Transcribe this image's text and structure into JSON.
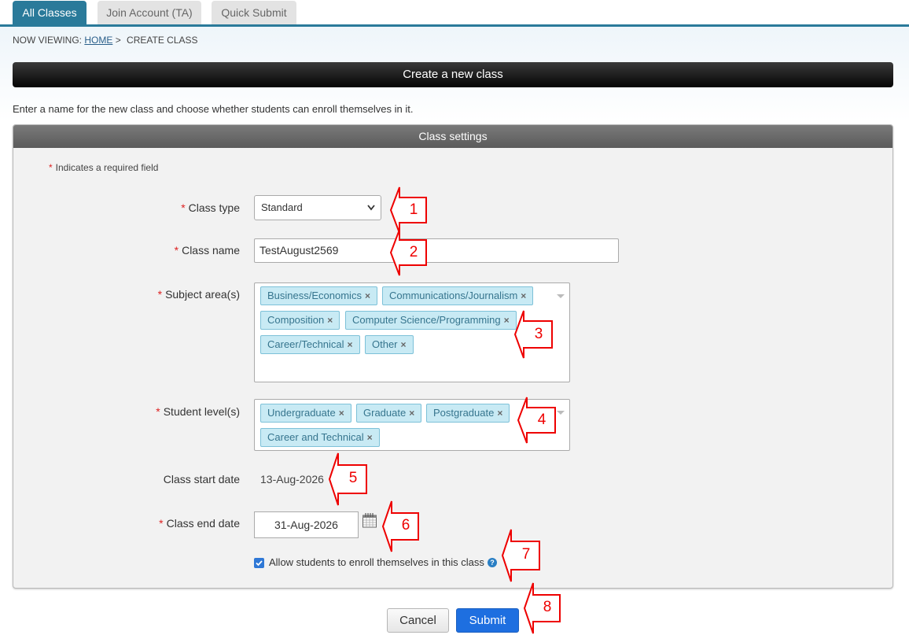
{
  "tabs": [
    {
      "label": "All Classes",
      "active": true
    },
    {
      "label": "Join Account (TA)",
      "active": false
    },
    {
      "label": "Quick Submit",
      "active": false
    }
  ],
  "breadcrumb": {
    "prefix": "NOW VIEWING:",
    "home": "HOME",
    "separator": ">",
    "current": "CREATE CLASS"
  },
  "page_title": "Create a new class",
  "intro_text": "Enter a name for the new class and choose whether students can enroll themselves in it.",
  "panel": {
    "title": "Class settings",
    "required_star": "*",
    "required_note": "Indicates a required field"
  },
  "fields": {
    "class_type": {
      "label": "Class type",
      "value": "Standard"
    },
    "class_name": {
      "label": "Class name",
      "value": "TestAugust2569"
    },
    "subject_areas": {
      "label": "Subject area(s)",
      "tags": [
        "Business/Economics",
        "Communications/Journalism",
        "Composition",
        "Computer Science/Programming",
        "Career/Technical",
        "Other"
      ]
    },
    "student_levels": {
      "label": "Student level(s)",
      "tags": [
        "Undergraduate",
        "Graduate",
        "Postgraduate",
        "Career and Technical"
      ]
    },
    "start_date": {
      "label": "Class start date",
      "value": "13-Aug-2026"
    },
    "end_date": {
      "label": "Class end date",
      "value": "31-Aug-2026"
    },
    "self_enroll": {
      "label": "Allow students to enroll themselves in this class",
      "checked": true,
      "help_glyph": "?"
    }
  },
  "tag_remove_glyph": "×",
  "buttons": {
    "cancel": "Cancel",
    "submit": "Submit"
  },
  "callouts": [
    "1",
    "2",
    "3",
    "4",
    "5",
    "6",
    "7",
    "8"
  ],
  "colors": {
    "accent": "#2a7a9a",
    "submit": "#1e6fe0",
    "tag_bg": "#c8eaf4",
    "callout": "#e00000"
  }
}
